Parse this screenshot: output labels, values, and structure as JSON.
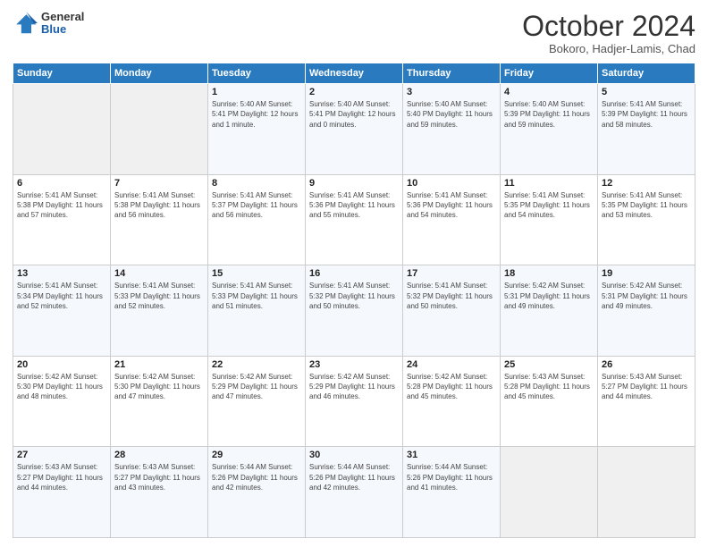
{
  "logo": {
    "general": "General",
    "blue": "Blue"
  },
  "title": "October 2024",
  "subtitle": "Bokoro, Hadjer-Lamis, Chad",
  "headers": [
    "Sunday",
    "Monday",
    "Tuesday",
    "Wednesday",
    "Thursday",
    "Friday",
    "Saturday"
  ],
  "weeks": [
    [
      {
        "day": "",
        "info": ""
      },
      {
        "day": "",
        "info": ""
      },
      {
        "day": "1",
        "info": "Sunrise: 5:40 AM\nSunset: 5:41 PM\nDaylight: 12 hours\nand 1 minute."
      },
      {
        "day": "2",
        "info": "Sunrise: 5:40 AM\nSunset: 5:41 PM\nDaylight: 12 hours\nand 0 minutes."
      },
      {
        "day": "3",
        "info": "Sunrise: 5:40 AM\nSunset: 5:40 PM\nDaylight: 11 hours\nand 59 minutes."
      },
      {
        "day": "4",
        "info": "Sunrise: 5:40 AM\nSunset: 5:39 PM\nDaylight: 11 hours\nand 59 minutes."
      },
      {
        "day": "5",
        "info": "Sunrise: 5:41 AM\nSunset: 5:39 PM\nDaylight: 11 hours\nand 58 minutes."
      }
    ],
    [
      {
        "day": "6",
        "info": "Sunrise: 5:41 AM\nSunset: 5:38 PM\nDaylight: 11 hours\nand 57 minutes."
      },
      {
        "day": "7",
        "info": "Sunrise: 5:41 AM\nSunset: 5:38 PM\nDaylight: 11 hours\nand 56 minutes."
      },
      {
        "day": "8",
        "info": "Sunrise: 5:41 AM\nSunset: 5:37 PM\nDaylight: 11 hours\nand 56 minutes."
      },
      {
        "day": "9",
        "info": "Sunrise: 5:41 AM\nSunset: 5:36 PM\nDaylight: 11 hours\nand 55 minutes."
      },
      {
        "day": "10",
        "info": "Sunrise: 5:41 AM\nSunset: 5:36 PM\nDaylight: 11 hours\nand 54 minutes."
      },
      {
        "day": "11",
        "info": "Sunrise: 5:41 AM\nSunset: 5:35 PM\nDaylight: 11 hours\nand 54 minutes."
      },
      {
        "day": "12",
        "info": "Sunrise: 5:41 AM\nSunset: 5:35 PM\nDaylight: 11 hours\nand 53 minutes."
      }
    ],
    [
      {
        "day": "13",
        "info": "Sunrise: 5:41 AM\nSunset: 5:34 PM\nDaylight: 11 hours\nand 52 minutes."
      },
      {
        "day": "14",
        "info": "Sunrise: 5:41 AM\nSunset: 5:33 PM\nDaylight: 11 hours\nand 52 minutes."
      },
      {
        "day": "15",
        "info": "Sunrise: 5:41 AM\nSunset: 5:33 PM\nDaylight: 11 hours\nand 51 minutes."
      },
      {
        "day": "16",
        "info": "Sunrise: 5:41 AM\nSunset: 5:32 PM\nDaylight: 11 hours\nand 50 minutes."
      },
      {
        "day": "17",
        "info": "Sunrise: 5:41 AM\nSunset: 5:32 PM\nDaylight: 11 hours\nand 50 minutes."
      },
      {
        "day": "18",
        "info": "Sunrise: 5:42 AM\nSunset: 5:31 PM\nDaylight: 11 hours\nand 49 minutes."
      },
      {
        "day": "19",
        "info": "Sunrise: 5:42 AM\nSunset: 5:31 PM\nDaylight: 11 hours\nand 49 minutes."
      }
    ],
    [
      {
        "day": "20",
        "info": "Sunrise: 5:42 AM\nSunset: 5:30 PM\nDaylight: 11 hours\nand 48 minutes."
      },
      {
        "day": "21",
        "info": "Sunrise: 5:42 AM\nSunset: 5:30 PM\nDaylight: 11 hours\nand 47 minutes."
      },
      {
        "day": "22",
        "info": "Sunrise: 5:42 AM\nSunset: 5:29 PM\nDaylight: 11 hours\nand 47 minutes."
      },
      {
        "day": "23",
        "info": "Sunrise: 5:42 AM\nSunset: 5:29 PM\nDaylight: 11 hours\nand 46 minutes."
      },
      {
        "day": "24",
        "info": "Sunrise: 5:42 AM\nSunset: 5:28 PM\nDaylight: 11 hours\nand 45 minutes."
      },
      {
        "day": "25",
        "info": "Sunrise: 5:43 AM\nSunset: 5:28 PM\nDaylight: 11 hours\nand 45 minutes."
      },
      {
        "day": "26",
        "info": "Sunrise: 5:43 AM\nSunset: 5:27 PM\nDaylight: 11 hours\nand 44 minutes."
      }
    ],
    [
      {
        "day": "27",
        "info": "Sunrise: 5:43 AM\nSunset: 5:27 PM\nDaylight: 11 hours\nand 44 minutes."
      },
      {
        "day": "28",
        "info": "Sunrise: 5:43 AM\nSunset: 5:27 PM\nDaylight: 11 hours\nand 43 minutes."
      },
      {
        "day": "29",
        "info": "Sunrise: 5:44 AM\nSunset: 5:26 PM\nDaylight: 11 hours\nand 42 minutes."
      },
      {
        "day": "30",
        "info": "Sunrise: 5:44 AM\nSunset: 5:26 PM\nDaylight: 11 hours\nand 42 minutes."
      },
      {
        "day": "31",
        "info": "Sunrise: 5:44 AM\nSunset: 5:26 PM\nDaylight: 11 hours\nand 41 minutes."
      },
      {
        "day": "",
        "info": ""
      },
      {
        "day": "",
        "info": ""
      }
    ]
  ]
}
